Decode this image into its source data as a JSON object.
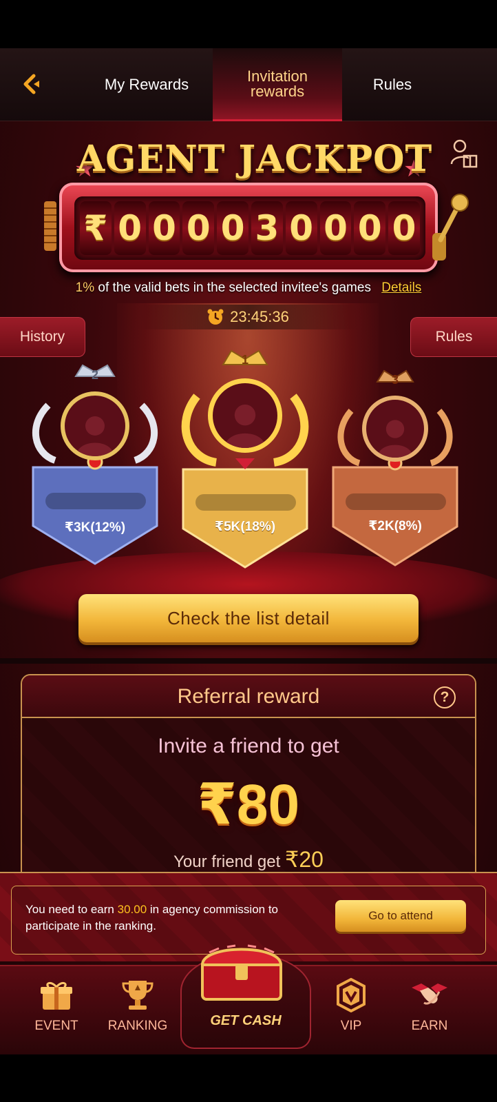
{
  "tabs": {
    "my_rewards": "My Rewards",
    "invitation_rewards": "Invitation\nrewards",
    "rules": "Rules"
  },
  "jackpot": {
    "title": "AGENT JACKPOT",
    "currency": "₹",
    "digits": [
      "0",
      "0",
      "0",
      "0",
      "3",
      "0",
      "0",
      "0",
      "0"
    ],
    "description_pct": "1%",
    "description_rest": " of the valid bets in the selected invitee's games",
    "details_link": "Details",
    "timer": "23:45:36"
  },
  "side_buttons": {
    "history": "History",
    "rules": "Rules"
  },
  "podium": [
    {
      "rank": "2",
      "prize": "₹3K(12%)"
    },
    {
      "rank": "1",
      "prize": "₹5K(18%)"
    },
    {
      "rank": "3",
      "prize": "₹2K(8%)"
    }
  ],
  "check_button": "Check the list detail",
  "referral": {
    "title": "Referral reward",
    "invite_text": "Invite a friend to get",
    "amount": "₹80",
    "friend_prefix": "Your friend get ",
    "friend_amount": "₹20"
  },
  "notice": {
    "text_before": "You need to earn ",
    "amount": "30.00",
    "text_after": " in agency commission to participate in the ranking.",
    "button": "Go to attend"
  },
  "bottom_nav": {
    "event": "EVENT",
    "ranking": "RANKING",
    "get_cash": "GET CASH",
    "vip": "VIP",
    "earn": "EARN"
  },
  "colors": {
    "accent_gold": "#ffd24d",
    "brand_red": "#8e1524",
    "background_dark": "#1c0406"
  }
}
